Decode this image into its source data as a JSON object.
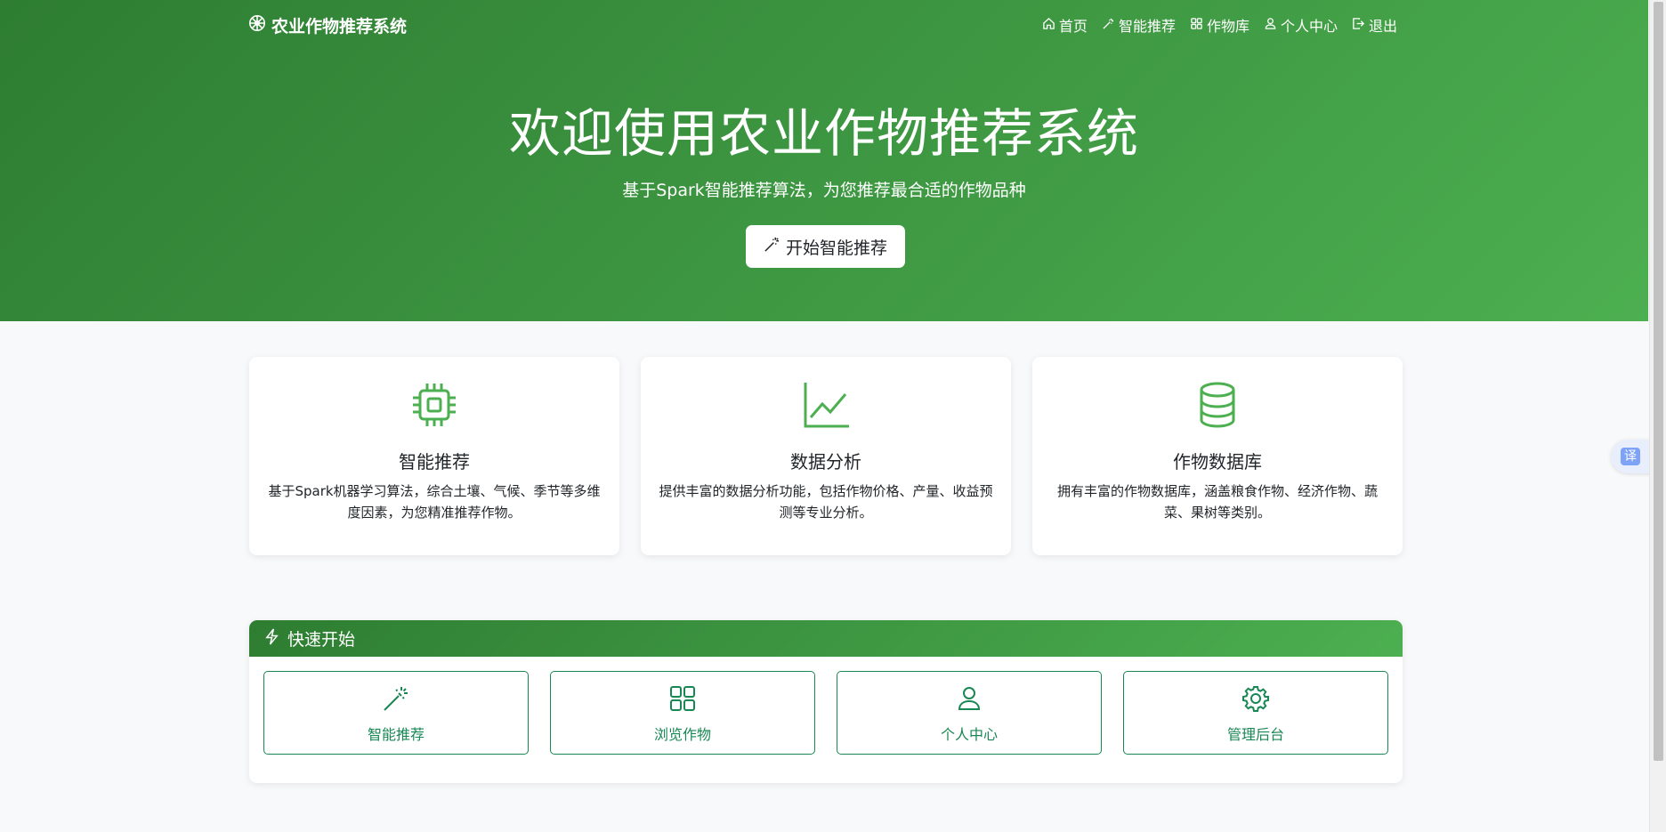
{
  "nav": {
    "brand": "农业作物推荐系统",
    "items": [
      {
        "label": "首页",
        "icon": "house-icon"
      },
      {
        "label": "智能推荐",
        "icon": "magic-wand-icon"
      },
      {
        "label": "作物库",
        "icon": "grid-icon"
      },
      {
        "label": "个人中心",
        "icon": "person-icon"
      },
      {
        "label": "退出",
        "icon": "logout-icon"
      }
    ]
  },
  "hero": {
    "title": "欢迎使用农业作物推荐系统",
    "subtitle": "基于Spark智能推荐算法，为您推荐最合适的作物品种",
    "button_label": "开始智能推荐"
  },
  "features": [
    {
      "icon": "cpu-icon",
      "title": "智能推荐",
      "desc": "基于Spark机器学习算法，综合土壤、气候、季节等多维度因素，为您精准推荐作物。"
    },
    {
      "icon": "line-chart-icon",
      "title": "数据分析",
      "desc": "提供丰富的数据分析功能，包括作物价格、产量、收益预测等专业分析。"
    },
    {
      "icon": "database-icon",
      "title": "作物数据库",
      "desc": "拥有丰富的作物数据库，涵盖粮食作物、经济作物、蔬菜、果树等类别。"
    }
  ],
  "quick_start": {
    "title": "快速开始",
    "buttons": [
      {
        "label": "智能推荐",
        "icon": "magic-wand-icon"
      },
      {
        "label": "浏览作物",
        "icon": "grid-icon"
      },
      {
        "label": "个人中心",
        "icon": "person-icon"
      },
      {
        "label": "管理后台",
        "icon": "gear-icon"
      }
    ]
  },
  "translate_widget": {
    "label": "译"
  },
  "colors": {
    "primary_dark": "#2e7d32",
    "primary_light": "#4caf50",
    "button_outline": "#198754",
    "page_bg": "#f8f9fa"
  }
}
